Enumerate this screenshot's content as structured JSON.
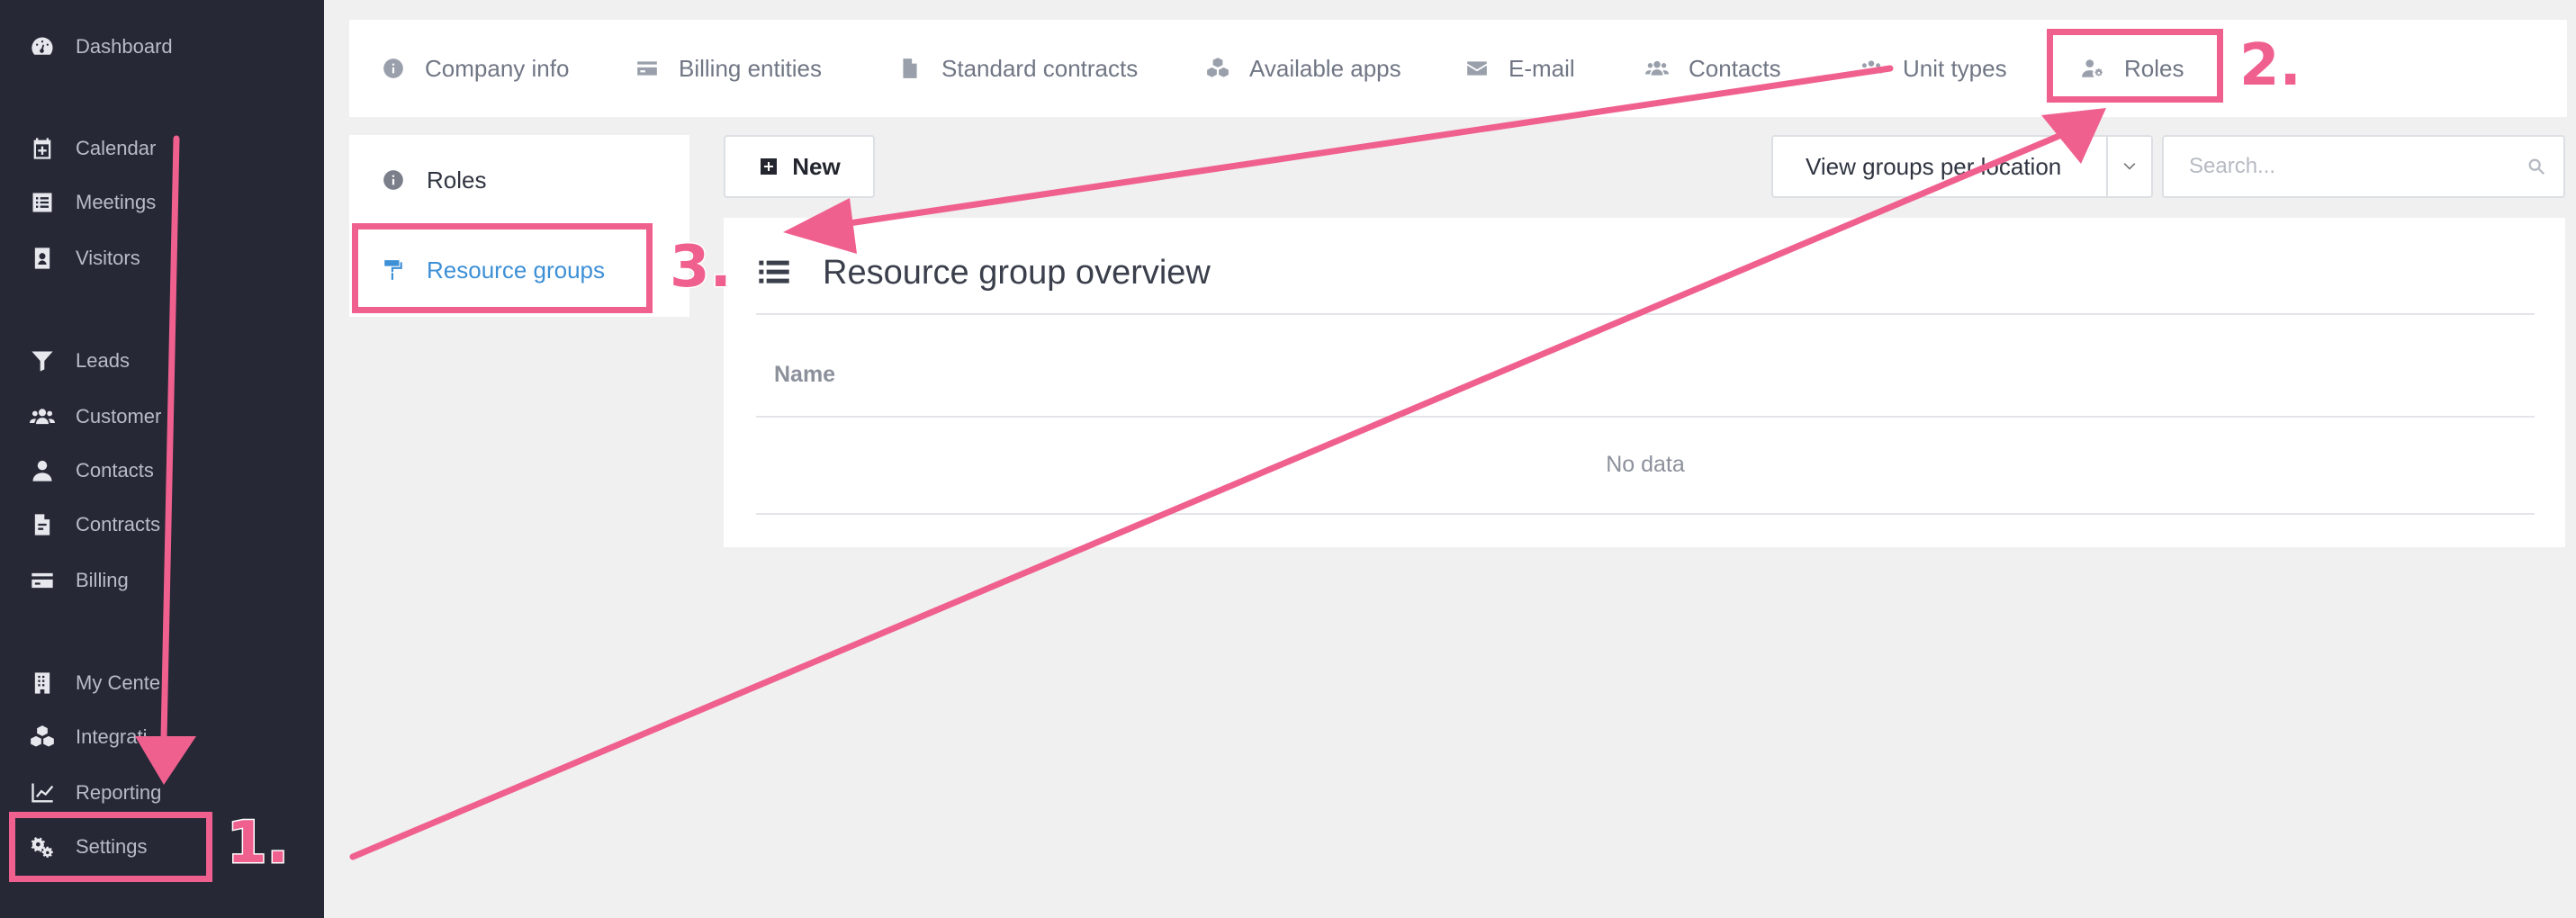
{
  "sidebar": {
    "items": [
      {
        "label": "Dashboard",
        "icon": "dashboard-icon"
      },
      {
        "label": "Calendar",
        "icon": "calendar-icon"
      },
      {
        "label": "Meetings",
        "icon": "meetings-icon"
      },
      {
        "label": "Visitors",
        "icon": "visitors-icon"
      },
      {
        "label": "Leads",
        "icon": "filter-icon"
      },
      {
        "label": "Customer",
        "icon": "users-icon"
      },
      {
        "label": "Contacts",
        "icon": "user-icon"
      },
      {
        "label": "Contracts",
        "icon": "contract-icon"
      },
      {
        "label": "Billing",
        "icon": "credit-card-icon"
      },
      {
        "label": "My Cente",
        "icon": "building-icon"
      },
      {
        "label": "Integrati",
        "icon": "cubes-icon"
      },
      {
        "label": "Reporting",
        "icon": "chart-line-icon"
      },
      {
        "label": "Settings",
        "icon": "cogs-icon"
      }
    ]
  },
  "tabs": [
    {
      "label": "Company info",
      "icon": "info-circle-icon"
    },
    {
      "label": "Billing entities",
      "icon": "credit-card-icon"
    },
    {
      "label": "Standard contracts",
      "icon": "file-icon"
    },
    {
      "label": "Available apps",
      "icon": "cubes-icon"
    },
    {
      "label": "E-mail",
      "icon": "envelope-icon"
    },
    {
      "label": "Contacts",
      "icon": "users-icon"
    },
    {
      "label": "Unit types",
      "icon": "users-group-icon"
    },
    {
      "label": "Roles",
      "icon": "user-cog-icon"
    }
  ],
  "submenu": {
    "items": [
      {
        "label": "Roles",
        "icon": "info-circle-icon"
      },
      {
        "label": "Resource groups",
        "icon": "paint-roller-icon",
        "active": true
      }
    ]
  },
  "toolbar": {
    "new_label": "New",
    "view_select_label": "View groups per location",
    "search_placeholder": "Search..."
  },
  "panel": {
    "title": "Resource group overview",
    "column_name": "Name",
    "empty_text": "No data"
  },
  "annotations": {
    "step1": "1.",
    "step2": "2.",
    "step3": "3.",
    "color": "#f0608f"
  },
  "colors": {
    "sidebar_bg": "#262835",
    "accent": "#3d8fd6",
    "annotation": "#f0608f"
  }
}
